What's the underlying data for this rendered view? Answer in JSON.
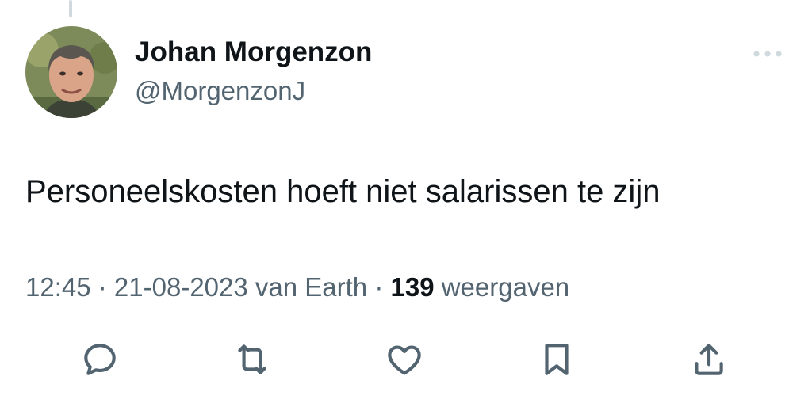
{
  "tweet": {
    "author": {
      "name": "Johan Morgenzon",
      "handle": "@MorgenzonJ"
    },
    "text": "Personeelskosten hoeft niet salarissen te zijn",
    "meta": {
      "time": "12:45",
      "separator": " · ",
      "date": "21-08-2023",
      "source": "van Earth",
      "views_count": "139",
      "views_label": "weergaven"
    },
    "actions": [
      {
        "icon": "reply-icon"
      },
      {
        "icon": "retweet-icon"
      },
      {
        "icon": "like-icon"
      },
      {
        "icon": "bookmark-icon"
      },
      {
        "icon": "share-icon"
      }
    ],
    "colors": {
      "primary_text": "#0f1419",
      "secondary_text": "#536471",
      "icon": "#536471",
      "thread_line": "#cfd9de"
    }
  }
}
